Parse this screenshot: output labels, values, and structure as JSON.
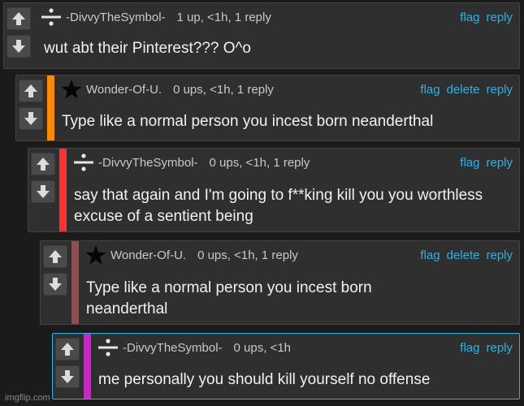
{
  "icons": {
    "upvote": "arrow-up-icon",
    "downvote": "arrow-down-icon",
    "divide": "divide-symbol-icon",
    "star": "star-icon"
  },
  "colors": {
    "link": "#27b4e6",
    "stripe_orange": "#ff8a00",
    "stripe_red": "#ff3030",
    "stripe_brown": "#8d4f4f",
    "stripe_magenta": "#d020d0"
  },
  "comments": [
    {
      "username": "-DivvyTheSymbol-",
      "stats": "1 up, <1h, 1 reply",
      "body": "wut abt their Pinterest??? O^o",
      "actions": [
        "flag",
        "reply"
      ]
    },
    {
      "username": "Wonder-Of-U.",
      "stats": "0 ups, <1h, 1 reply",
      "body": "Type like a normal person you incest born neanderthal",
      "actions": [
        "flag",
        "delete",
        "reply"
      ]
    },
    {
      "username": "-DivvyTheSymbol-",
      "stats": "0 ups, <1h, 1 reply",
      "body": "say that again and I'm going to f**king kill you you worthless excuse of a sentient being",
      "actions": [
        "flag",
        "reply"
      ]
    },
    {
      "username": "Wonder-Of-U.",
      "stats": "0 ups, <1h, 1 reply",
      "body": "Type like a normal person you incest born neanderthal",
      "actions": [
        "flag",
        "delete",
        "reply"
      ]
    },
    {
      "username": "-DivvyTheSymbol-",
      "stats": "0 ups, <1h",
      "body": "me personally you should kill yourself no offense",
      "actions": [
        "flag",
        "reply"
      ]
    }
  ],
  "watermark": "imgflip.com"
}
